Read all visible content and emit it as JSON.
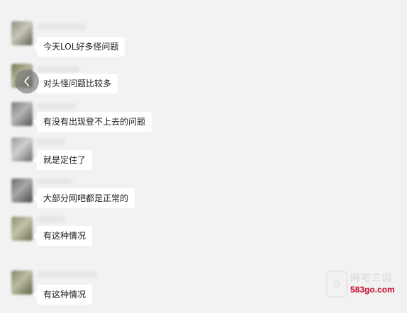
{
  "chat": {
    "messages": [
      {
        "text": "今天LOL好多怪问题",
        "avatar_colors": [
          "#8a8f7a",
          "#c9c6b8",
          "#5d6350"
        ]
      },
      {
        "text": "对头怪问题比较多",
        "avatar_colors": [
          "#6f7a55",
          "#b8b39a",
          "#4c5540"
        ]
      },
      {
        "text": "有没有出现登不上去的问题",
        "avatar_colors": [
          "#7d7d7d",
          "#b5b5b5",
          "#555555"
        ]
      },
      {
        "text": "就是定住了",
        "avatar_colors": [
          "#9a9a9a",
          "#d0d0d0",
          "#6a6a6a"
        ]
      },
      {
        "text": "大部分网吧都是正常的",
        "avatar_colors": [
          "#6b6b6b",
          "#a8a8a8",
          "#4a4a4a"
        ]
      },
      {
        "text": "有这种情况",
        "avatar_colors": [
          "#8b8f6e",
          "#c4c2a8",
          "#6a6e50"
        ]
      },
      {
        "text": "有这种情况",
        "avatar_colors": [
          "#7e8a6a",
          "#bdbba2",
          "#5b6448"
        ]
      }
    ]
  },
  "nav": {
    "back_icon": "chevron-left-icon"
  },
  "watermark": {
    "cn": "网吧三国",
    "url": "583go.com",
    "logo_glyph": "5"
  }
}
